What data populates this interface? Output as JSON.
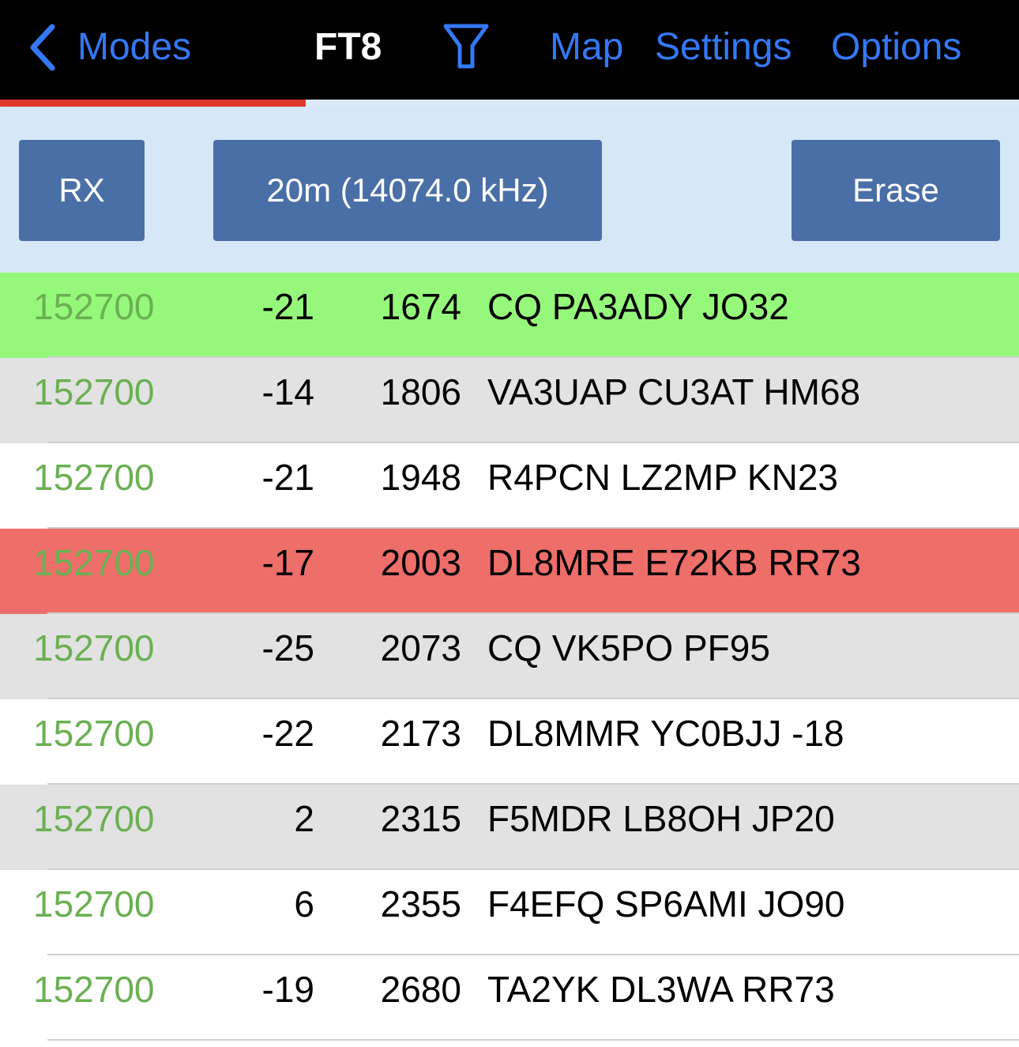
{
  "nav": {
    "back_label": "Modes",
    "title": "FT8",
    "filter_icon": "filter-funnel-icon",
    "map_label": "Map",
    "settings_label": "Settings",
    "options_label": "Options"
  },
  "progress": {
    "fraction": 0.3
  },
  "toolbar": {
    "rx_label": "RX",
    "band_label": "20m (14074.0 kHz)",
    "erase_label": "Erase"
  },
  "decodes": [
    {
      "time": "152700",
      "snr": "-21",
      "freq": "1674",
      "message": "CQ PA3ADY JO32",
      "highlight": "cq"
    },
    {
      "time": "152700",
      "snr": "-14",
      "freq": "1806",
      "message": "VA3UAP CU3AT HM68",
      "highlight": "alt"
    },
    {
      "time": "152700",
      "snr": "-21",
      "freq": "1948",
      "message": "R4PCN LZ2MP KN23",
      "highlight": "none"
    },
    {
      "time": "152700",
      "snr": "-17",
      "freq": "2003",
      "message": "DL8MRE E72KB RR73",
      "highlight": "mine"
    },
    {
      "time": "152700",
      "snr": "-25",
      "freq": "2073",
      "message": "CQ VK5PO PF95",
      "highlight": "alt"
    },
    {
      "time": "152700",
      "snr": "-22",
      "freq": "2173",
      "message": "DL8MMR YC0BJJ -18",
      "highlight": "none"
    },
    {
      "time": "152700",
      "snr": "2",
      "freq": "2315",
      "message": "F5MDR LB8OH JP20",
      "highlight": "alt"
    },
    {
      "time": "152700",
      "snr": "6",
      "freq": "2355",
      "message": "F4EFQ SP6AMI JO90",
      "highlight": "none"
    },
    {
      "time": "152700",
      "snr": "-19",
      "freq": "2680",
      "message": "TA2YK DL3WA RR73",
      "highlight": "none"
    }
  ],
  "colors": {
    "nav_background": "#000000",
    "link": "#3478f6",
    "progress": "#e0392b",
    "toolbar_background": "#d6e8f8",
    "button": "#4a6fa7",
    "time_text": "#6bb053",
    "row_cq": "#96f87b",
    "row_alt": "#e2e2e2",
    "row_mine": "#ee6e6a",
    "row_default": "#ffffff"
  }
}
